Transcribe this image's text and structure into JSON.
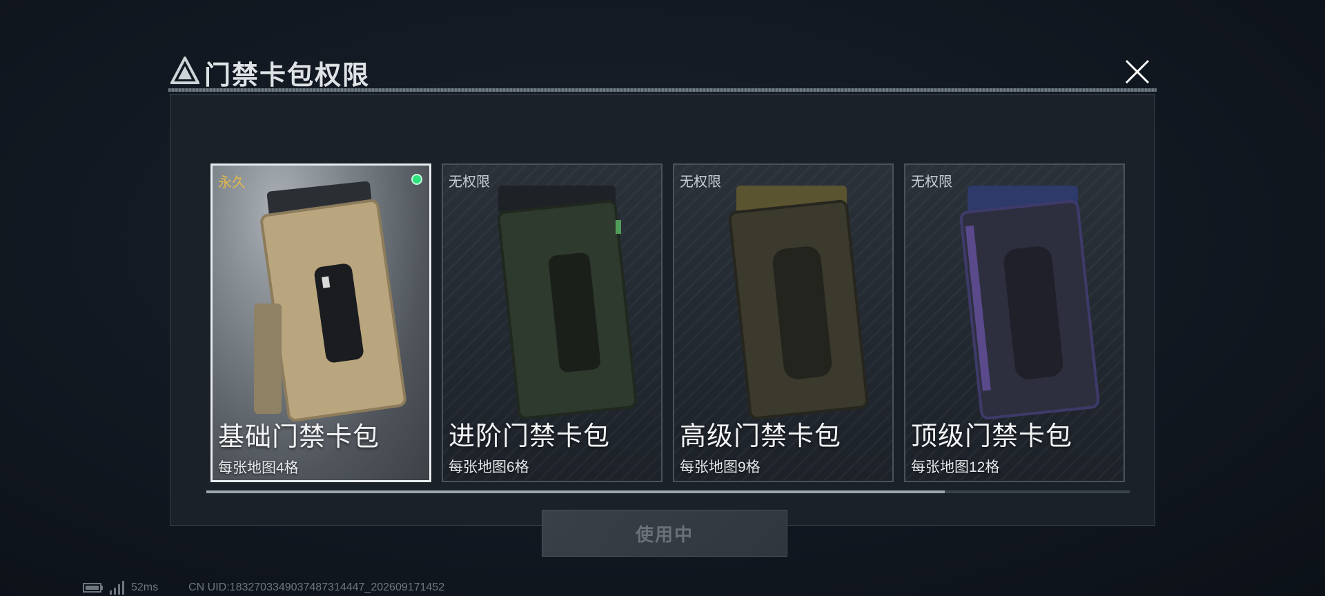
{
  "dialog": {
    "title": "门禁卡包权限",
    "icon": "triangle-logo-icon",
    "close_icon": "close-icon"
  },
  "cards": [
    {
      "badge": "永久",
      "name": "基础门禁卡包",
      "desc": "每张地图4格",
      "selected": true,
      "status": "active-dot",
      "theme": "#b9a57e"
    },
    {
      "badge": "无权限",
      "name": "进阶门禁卡包",
      "desc": "每张地图6格",
      "selected": false,
      "theme": "#3d4a3c"
    },
    {
      "badge": "无权限",
      "name": "高级门禁卡包",
      "desc": "每张地图9格",
      "selected": false,
      "theme": "#4a4632"
    },
    {
      "badge": "无权限",
      "name": "顶级门禁卡包",
      "desc": "每张地图12格",
      "selected": false,
      "theme": "#3b3f5a"
    }
  ],
  "scroll_progress": 0.8,
  "action_button": {
    "label": "使用中",
    "disabled": true
  },
  "footer": {
    "ping": "52ms",
    "uid": "CN UID:1832703349037487314447_202609171452"
  },
  "colors": {
    "accent_badge": "#e3b84b",
    "status_dot": "#2ee37e",
    "selected_border": "#e9ecef"
  }
}
